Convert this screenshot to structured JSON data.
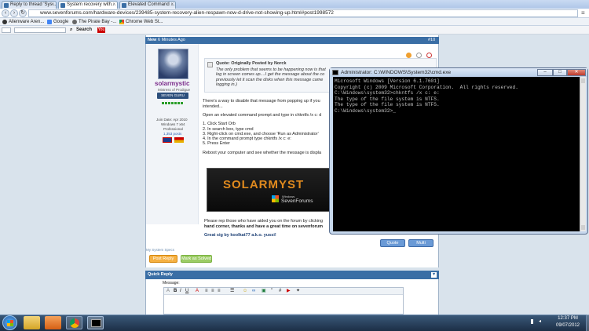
{
  "browser": {
    "tabs": [
      {
        "label": "Reply to thread 'Sys..."
      },
      {
        "label": "System recovery with..."
      },
      {
        "label": "Elevated Command ..."
      }
    ],
    "url": "www.sevenforums.com/hardware-devices/239485-system-recovery-alien-respawn-now-d-drive-not-showing-up.html#post1998572",
    "bookmarks": [
      {
        "label": "Alienware Aren..."
      },
      {
        "label": "Google"
      },
      {
        "label": "The Pirate Bay -..."
      },
      {
        "label": "Chrome Web St..."
      }
    ],
    "search_label": "Search",
    "yt_label": "You"
  },
  "post": {
    "badge": "New",
    "time": "6 Minutes Ago",
    "post_number": "#10",
    "username": "solarmystic",
    "user_title": "Mistress of Prodigue",
    "rank_badge": "SEVEN GURU",
    "join_date": "Join Date: Apr 2010",
    "os_info": "Windows 7 x64",
    "os_edition": "Professional",
    "post_count": "1,353 posts",
    "quote_header": "Quote: Originally Posted by Norck",
    "quote_lines": [
      "The only problem that seems to be happening now is that",
      "log in screen comes up....I get the message about the co",
      "previously let it scan the disks when this message came",
      "logging in.)"
    ],
    "intro_text": "There's a way to disable that message from popping up if you",
    "intro_text_2": "intended...",
    "instruction": "Open an elevated command prompt and type in chkntfs /x c: d",
    "steps": [
      "1. Click Start Orb",
      "2. In search box, type cmd",
      "3. Right-click on cmd.exe, and choose 'Run as Administrator'",
      "4. In the command prompt type chkntfs /x c: e:",
      "5. Press Enter"
    ],
    "reboot_text": "Reboot your computer and see whether the message is displa",
    "sig_banner_text": "SOLARMYST",
    "sig_banner_sub": "Windows",
    "sig_banner_brand": "SevenForums",
    "sig_rep_line_1": "Please rep those who have aided you on the forum by clicking",
    "sig_rep_line_2": "hand corner, thanks and have a great time on sevenforum",
    "sig_credit": "Great sig by koolkat77 a.k.o. yussi!",
    "system_spec": "My System Specs",
    "quote_btn": "Quote",
    "multi_btn": "Multi",
    "post_reply_btn": "Post Reply",
    "mark_solved_btn": "Mark as Solved"
  },
  "quick_reply": {
    "title": "Quick Reply",
    "message_label": "Message:"
  },
  "cmd": {
    "title": "Administrator: C:\\WINDOWS\\System32\\cmd.exe",
    "lines": [
      "Microsoft Windows [Version 6.1.7601]",
      "Copyright (c) 2009 Microsoft Corporation.  All rights reserved.",
      "",
      "C:\\Windows\\system32>chkntfs /x c: e:",
      "The type of the file system is NTFS.",
      "The type of the file system is NTFS.",
      "",
      "C:\\Windows\\system32>_"
    ]
  },
  "taskbar": {
    "time": "12:37 PM",
    "date": "09/07/2012"
  },
  "colors": {
    "accent": "#3a6ea5",
    "taskbar": "#1c2f46",
    "cmd_bg": "#000000"
  }
}
